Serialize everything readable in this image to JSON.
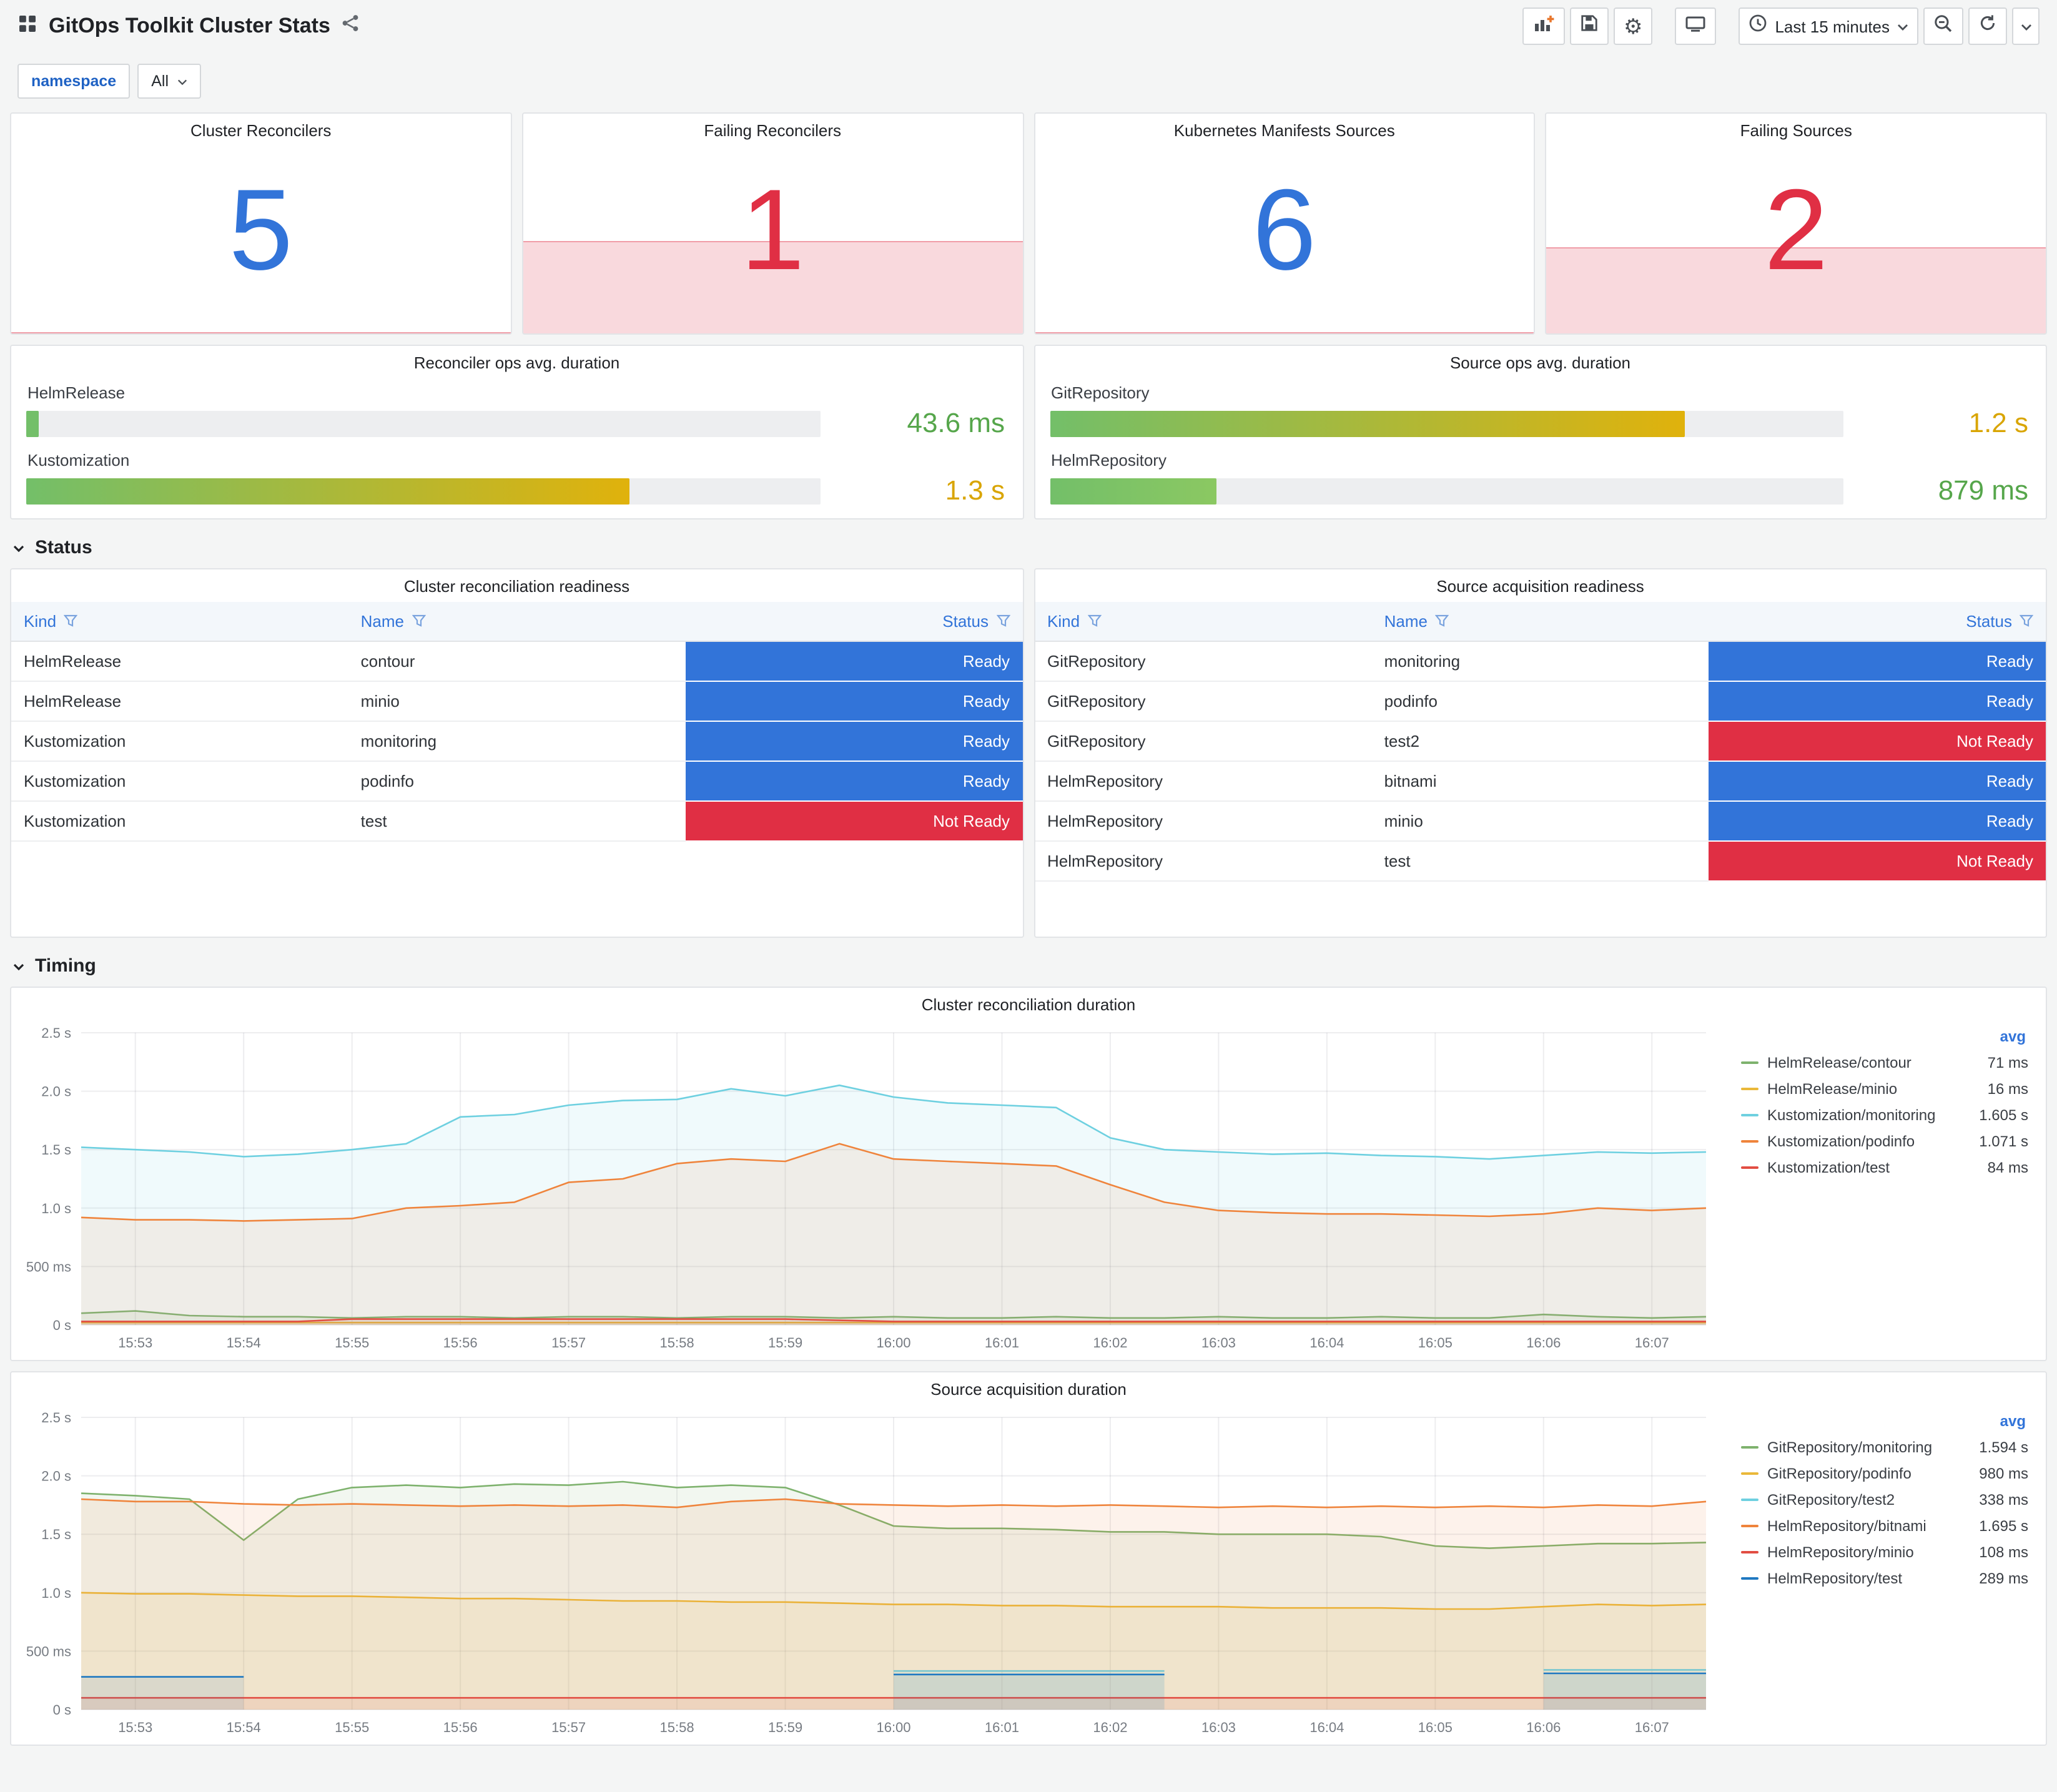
{
  "header": {
    "title": "GitOps Toolkit Cluster Stats",
    "time_range": "Last 15 minutes"
  },
  "variables": {
    "label": "namespace",
    "value": "All"
  },
  "sections": {
    "status": "Status",
    "timing": "Timing"
  },
  "stats": [
    {
      "title": "Cluster Reconcilers",
      "value": "5",
      "color": "#3274D9",
      "band_pct": 0
    },
    {
      "title": "Failing Reconcilers",
      "value": "1",
      "color": "#E02F44",
      "band_pct": 42
    },
    {
      "title": "Kubernetes Manifests Sources",
      "value": "6",
      "color": "#3274D9",
      "band_pct": 0
    },
    {
      "title": "Failing Sources",
      "value": "2",
      "color": "#E02F44",
      "band_pct": 39
    }
  ],
  "gauges": [
    {
      "title": "Reconciler ops avg. duration",
      "rows": [
        {
          "label": "HelmRelease",
          "value": "43.6 ms",
          "pct": 1.5,
          "bar_from": "#73BF69",
          "bar_to": "#73BF69",
          "value_color": "#56A64B"
        },
        {
          "label": "Kustomization",
          "value": "1.3 s",
          "pct": 76,
          "bar_from": "#73BF69",
          "bar_to": "#E0B20C",
          "value_color": "#D9A502"
        }
      ]
    },
    {
      "title": "Source ops avg. duration",
      "rows": [
        {
          "label": "GitRepository",
          "value": "1.2 s",
          "pct": 80,
          "bar_from": "#73BF69",
          "bar_to": "#E0B20C",
          "value_color": "#D9A502"
        },
        {
          "label": "HelmRepository",
          "value": "879 ms",
          "pct": 21,
          "bar_from": "#73BF69",
          "bar_to": "#8BC862",
          "value_color": "#56A64B"
        }
      ]
    }
  ],
  "tables": [
    {
      "title": "Cluster reconciliation readiness",
      "columns": [
        "Kind",
        "Name",
        "Status"
      ],
      "rows": [
        {
          "kind": "HelmRelease",
          "name": "contour",
          "status": "Ready",
          "state": "ready"
        },
        {
          "kind": "HelmRelease",
          "name": "minio",
          "status": "Ready",
          "state": "ready"
        },
        {
          "kind": "Kustomization",
          "name": "monitoring",
          "status": "Ready",
          "state": "ready"
        },
        {
          "kind": "Kustomization",
          "name": "podinfo",
          "status": "Ready",
          "state": "ready"
        },
        {
          "kind": "Kustomization",
          "name": "test",
          "status": "Not Ready",
          "state": "not-ready"
        }
      ]
    },
    {
      "title": "Source acquisition readiness",
      "columns": [
        "Kind",
        "Name",
        "Status"
      ],
      "rows": [
        {
          "kind": "GitRepository",
          "name": "monitoring",
          "status": "Ready",
          "state": "ready"
        },
        {
          "kind": "GitRepository",
          "name": "podinfo",
          "status": "Ready",
          "state": "ready"
        },
        {
          "kind": "GitRepository",
          "name": "test2",
          "status": "Not Ready",
          "state": "not-ready"
        },
        {
          "kind": "HelmRepository",
          "name": "bitnami",
          "status": "Ready",
          "state": "ready"
        },
        {
          "kind": "HelmRepository",
          "name": "minio",
          "status": "Ready",
          "state": "ready"
        },
        {
          "kind": "HelmRepository",
          "name": "test",
          "status": "Not Ready",
          "state": "not-ready"
        }
      ]
    }
  ],
  "chart_data": [
    {
      "type": "line",
      "title": "Cluster reconciliation duration",
      "xlabel": "",
      "ylabel": "duration",
      "ylim": [
        0,
        2.5
      ],
      "x_domain": [
        0,
        15
      ],
      "x_step": 0.5,
      "grid": true,
      "legend_position": "right",
      "legend_header": "avg",
      "y_ticks": [
        {
          "v": 0,
          "label": "0 s"
        },
        {
          "v": 0.5,
          "label": "500 ms"
        },
        {
          "v": 1,
          "label": "1.0 s"
        },
        {
          "v": 1.5,
          "label": "1.5 s"
        },
        {
          "v": 2,
          "label": "2.0 s"
        },
        {
          "v": 2.5,
          "label": "2.5 s"
        }
      ],
      "tick_pos": [
        0.5,
        1.5,
        2.5,
        3.5,
        4.5,
        5.5,
        6.5,
        7.5,
        8.5,
        9.5,
        10.5,
        11.5,
        12.5,
        13.5,
        14.5
      ],
      "x_ticks": [
        "15:53",
        "15:54",
        "15:55",
        "15:56",
        "15:57",
        "15:58",
        "15:59",
        "16:00",
        "16:01",
        "16:02",
        "16:03",
        "16:04",
        "16:05",
        "16:06",
        "16:07"
      ],
      "series": [
        {
          "name": "HelmRelease/contour",
          "color": "#7EB26D",
          "avg": "71 ms",
          "values": [
            0.1,
            0.12,
            0.08,
            0.07,
            0.07,
            0.06,
            0.07,
            0.07,
            0.06,
            0.07,
            0.07,
            0.06,
            0.07,
            0.07,
            0.06,
            0.07,
            0.06,
            0.06,
            0.07,
            0.06,
            0.06,
            0.07,
            0.06,
            0.06,
            0.07,
            0.06,
            0.06,
            0.09,
            0.07,
            0.06,
            0.07
          ]
        },
        {
          "name": "HelmRelease/minio",
          "color": "#EAB839",
          "avg": "16 ms",
          "values": [
            0.02,
            0.02,
            0.02,
            0.02,
            0.02,
            0.02,
            0.02,
            0.02,
            0.02,
            0.02,
            0.02,
            0.02,
            0.02,
            0.02,
            0.02,
            0.02,
            0.02,
            0.02,
            0.02,
            0.02,
            0.02,
            0.02,
            0.02,
            0.02,
            0.02,
            0.02,
            0.02,
            0.02,
            0.02,
            0.02,
            0.02
          ]
        },
        {
          "name": "Kustomization/monitoring",
          "color": "#6ED0E0",
          "avg": "1.605 s",
          "values": [
            1.52,
            1.5,
            1.48,
            1.44,
            1.46,
            1.5,
            1.55,
            1.78,
            1.8,
            1.88,
            1.92,
            1.93,
            2.02,
            1.96,
            2.05,
            1.95,
            1.9,
            1.88,
            1.86,
            1.6,
            1.5,
            1.48,
            1.46,
            1.47,
            1.45,
            1.44,
            1.42,
            1.45,
            1.48,
            1.47,
            1.48
          ]
        },
        {
          "name": "Kustomization/podinfo",
          "color": "#EF843C",
          "avg": "1.071 s",
          "values": [
            0.92,
            0.9,
            0.9,
            0.89,
            0.9,
            0.91,
            1.0,
            1.02,
            1.05,
            1.22,
            1.25,
            1.38,
            1.42,
            1.4,
            1.55,
            1.42,
            1.4,
            1.38,
            1.36,
            1.2,
            1.05,
            0.98,
            0.96,
            0.95,
            0.95,
            0.94,
            0.93,
            0.95,
            1.0,
            0.98,
            1.0
          ]
        },
        {
          "name": "Kustomization/test",
          "color": "#E24D42",
          "avg": "84 ms",
          "values": [
            0.03,
            0.03,
            0.03,
            0.03,
            0.03,
            0.05,
            0.05,
            0.05,
            0.05,
            0.05,
            0.05,
            0.05,
            0.05,
            0.05,
            0.04,
            0.03,
            0.03,
            0.03,
            0.03,
            0.03,
            0.03,
            0.03,
            0.03,
            0.03,
            0.03,
            0.03,
            0.03,
            0.03,
            0.03,
            0.03,
            0.03
          ]
        }
      ]
    },
    {
      "type": "line",
      "title": "Source acquisition duration",
      "xlabel": "",
      "ylabel": "duration",
      "ylim": [
        0,
        2.5
      ],
      "x_domain": [
        0,
        15
      ],
      "x_step": 0.5,
      "grid": true,
      "legend_position": "right",
      "legend_header": "avg",
      "y_ticks": [
        {
          "v": 0,
          "label": "0 s"
        },
        {
          "v": 0.5,
          "label": "500 ms"
        },
        {
          "v": 1,
          "label": "1.0 s"
        },
        {
          "v": 1.5,
          "label": "1.5 s"
        },
        {
          "v": 2,
          "label": "2.0 s"
        },
        {
          "v": 2.5,
          "label": "2.5 s"
        }
      ],
      "tick_pos": [
        0.5,
        1.5,
        2.5,
        3.5,
        4.5,
        5.5,
        6.5,
        7.5,
        8.5,
        9.5,
        10.5,
        11.5,
        12.5,
        13.5,
        14.5
      ],
      "x_ticks": [
        "15:53",
        "15:54",
        "15:55",
        "15:56",
        "15:57",
        "15:58",
        "15:59",
        "16:00",
        "16:01",
        "16:02",
        "16:03",
        "16:04",
        "16:05",
        "16:06",
        "16:07"
      ],
      "series": [
        {
          "name": "GitRepository/monitoring",
          "color": "#7EB26D",
          "avg": "1.594 s",
          "values": [
            1.85,
            1.83,
            1.8,
            1.45,
            1.8,
            1.9,
            1.92,
            1.9,
            1.93,
            1.92,
            1.95,
            1.9,
            1.92,
            1.9,
            1.75,
            1.57,
            1.55,
            1.55,
            1.54,
            1.52,
            1.52,
            1.5,
            1.5,
            1.5,
            1.48,
            1.4,
            1.38,
            1.4,
            1.42,
            1.42,
            1.43
          ]
        },
        {
          "name": "GitRepository/podinfo",
          "color": "#EAB839",
          "avg": "980 ms",
          "values": [
            1.0,
            0.99,
            0.99,
            0.98,
            0.97,
            0.97,
            0.96,
            0.95,
            0.95,
            0.94,
            0.93,
            0.93,
            0.92,
            0.92,
            0.91,
            0.9,
            0.9,
            0.89,
            0.89,
            0.88,
            0.88,
            0.88,
            0.87,
            0.87,
            0.87,
            0.86,
            0.86,
            0.88,
            0.9,
            0.89,
            0.9
          ]
        },
        {
          "name": "GitRepository/test2",
          "color": "#6ED0E0",
          "avg": "338 ms",
          "values": [
            null,
            null,
            null,
            null,
            null,
            null,
            null,
            null,
            null,
            null,
            null,
            null,
            null,
            null,
            null,
            0.33,
            0.33,
            0.33,
            0.33,
            0.33,
            0.33,
            null,
            null,
            null,
            null,
            null,
            null,
            0.34,
            0.34,
            0.34,
            0.34
          ]
        },
        {
          "name": "HelmRepository/bitnami",
          "color": "#EF843C",
          "avg": "1.695 s",
          "values": [
            1.8,
            1.78,
            1.78,
            1.76,
            1.75,
            1.76,
            1.75,
            1.74,
            1.75,
            1.74,
            1.75,
            1.73,
            1.78,
            1.8,
            1.76,
            1.75,
            1.74,
            1.75,
            1.74,
            1.75,
            1.74,
            1.73,
            1.74,
            1.73,
            1.74,
            1.73,
            1.74,
            1.73,
            1.75,
            1.74,
            1.78
          ]
        },
        {
          "name": "HelmRepository/minio",
          "color": "#E24D42",
          "avg": "108 ms",
          "values": [
            0.1,
            0.1,
            0.1,
            0.1,
            0.1,
            0.1,
            0.1,
            0.1,
            0.1,
            0.1,
            0.1,
            0.1,
            0.1,
            0.1,
            0.1,
            0.1,
            0.1,
            0.1,
            0.1,
            0.1,
            0.1,
            0.1,
            0.1,
            0.1,
            0.1,
            0.1,
            0.1,
            0.1,
            0.1,
            0.1,
            0.1
          ]
        },
        {
          "name": "HelmRepository/test",
          "color": "#1F78C1",
          "avg": "289 ms",
          "values": [
            0.28,
            0.28,
            0.28,
            0.28,
            null,
            null,
            null,
            null,
            null,
            null,
            null,
            null,
            null,
            null,
            null,
            0.3,
            0.3,
            0.3,
            0.3,
            0.3,
            0.3,
            null,
            null,
            null,
            null,
            null,
            null,
            0.31,
            0.31,
            0.31,
            0.31
          ]
        }
      ]
    }
  ]
}
